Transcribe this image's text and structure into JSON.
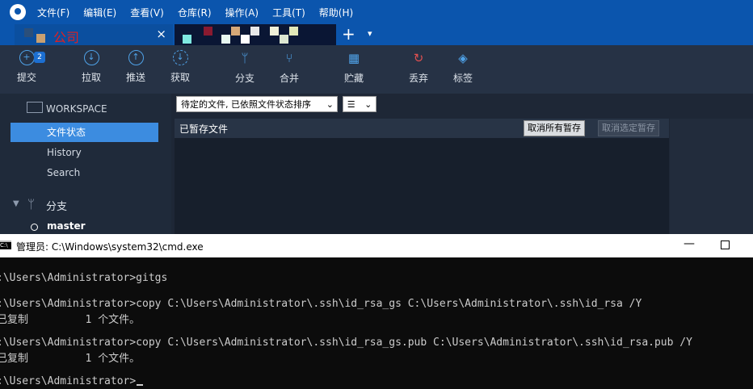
{
  "menu": [
    "文件(F)",
    "编辑(E)",
    "查看(V)",
    "仓库(R)",
    "操作(A)",
    "工具(T)",
    "帮助(H)"
  ],
  "tab": {
    "label": "公司",
    "close": "×",
    "new_tab": "+",
    "menu": "▾"
  },
  "toolbar": {
    "commit": "提交",
    "commit_badge": "2",
    "pull": "拉取",
    "push": "推送",
    "fetch": "获取",
    "branch": "分支",
    "merge": "合并",
    "stash": "贮藏",
    "discard": "丢弃",
    "tag": "标签"
  },
  "sidebar": {
    "workspace": "WORKSPACE",
    "items": [
      "文件状态",
      "History",
      "Search"
    ],
    "branches_title": "分支",
    "current_branch": "master"
  },
  "main": {
    "sort_select": "待定的文件, 已依照文件状态排序",
    "view_select": "☰",
    "staged_title": "已暂存文件",
    "unstage_all": "取消所有暂存",
    "unstage_selected": "取消选定暂存"
  },
  "cmd": {
    "title": "管理员: C:\\Windows\\system32\\cmd.exe",
    "lines": [
      ":\\Users\\Administrator>gitgs",
      "",
      ":\\Users\\Administrator>copy C:\\Users\\Administrator\\.ssh\\id_rsa_gs C:\\Users\\Administrator\\.ssh\\id_rsa /Y",
      "已复制         1 个文件。",
      "",
      ":\\Users\\Administrator>copy C:\\Users\\Administrator\\.ssh\\id_rsa_gs.pub C:\\Users\\Administrator\\.ssh\\id_rsa.pub /Y",
      "已复制         1 个文件。",
      "",
      ":\\Users\\Administrator>"
    ]
  },
  "colors": {
    "titlebar": "#0b55ad",
    "toolbar": "#263245",
    "accent": "#3c8ce0",
    "console_bg": "#0c0c0c"
  },
  "icons": [
    "app-logo-icon",
    "plus-circle-icon",
    "arrow-down-circle-icon",
    "arrow-up-circle-icon",
    "fetch-circle-icon",
    "branch-icon",
    "merge-icon",
    "stash-icon",
    "discard-icon",
    "tag-icon",
    "monitor-icon",
    "chevron-down-icon",
    "cmd-app-icon"
  ]
}
